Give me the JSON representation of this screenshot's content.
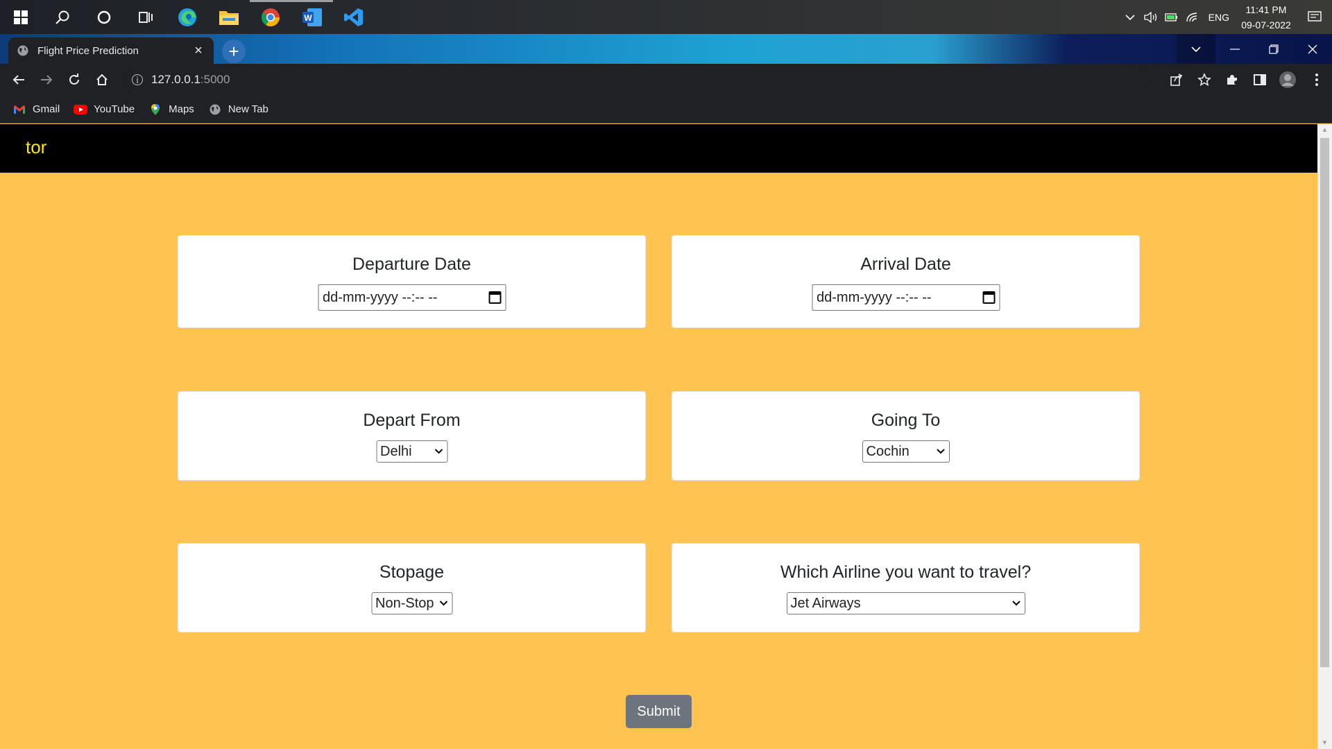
{
  "taskbar": {
    "apps": [
      "windows-start-icon",
      "search-icon",
      "cortana-icon",
      "task-view-icon",
      "edge-icon",
      "file-explorer-icon",
      "chrome-icon",
      "word-icon",
      "vscode-icon"
    ],
    "language": "ENG",
    "time": "11:41 PM",
    "date": "09-07-2022"
  },
  "browser": {
    "tab_title": "Flight Price Prediction",
    "url_host": "127.0.0.1",
    "url_port": ":5000",
    "bookmarks": [
      {
        "label": "Gmail",
        "icon": "gmail-icon"
      },
      {
        "label": "YouTube",
        "icon": "youtube-icon"
      },
      {
        "label": "Maps",
        "icon": "maps-icon"
      },
      {
        "label": "New Tab",
        "icon": "globe-icon"
      }
    ]
  },
  "page": {
    "brand": "tor",
    "departure": {
      "label": "Departure Date",
      "value": "dd-mm-yyyy --:-- --"
    },
    "arrival": {
      "label": "Arrival Date",
      "value": "dd-mm-yyyy --:-- --"
    },
    "source": {
      "label": "Depart From",
      "selected": "Delhi"
    },
    "destination": {
      "label": "Going To",
      "selected": "Cochin"
    },
    "stops": {
      "label": "Stopage",
      "selected": "Non-Stop"
    },
    "airline": {
      "label": "Which Airline you want to travel?",
      "selected": "Jet Airways"
    },
    "submit_label": "Submit"
  },
  "colors": {
    "page_background": "#ffc34f",
    "navbar": "#000000",
    "brand_text": "#ffe600",
    "submit_button": "#6c757d"
  }
}
